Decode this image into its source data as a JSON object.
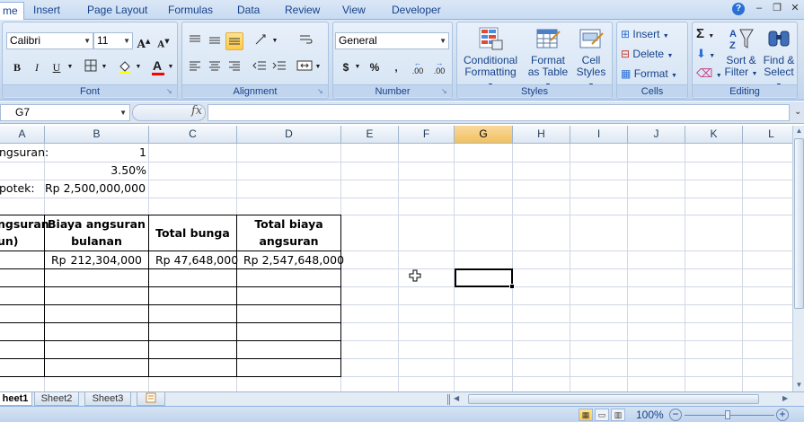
{
  "ribbon_tabs": [
    {
      "label": "me"
    },
    {
      "label": "Insert"
    },
    {
      "label": "Page Layout"
    },
    {
      "label": "Formulas"
    },
    {
      "label": "Data"
    },
    {
      "label": "Review"
    },
    {
      "label": "View"
    },
    {
      "label": "Developer"
    }
  ],
  "window_controls": {
    "minimize": "–",
    "restore": "❐",
    "close": "✕"
  },
  "groups": {
    "font": "Font",
    "alignment": "Alignment",
    "number": "Number",
    "styles": "Styles",
    "cells": "Cells",
    "editing": "Editing"
  },
  "font": {
    "name": "Calibri",
    "size": "11",
    "grow_icon": "A",
    "shrink_icon": "A",
    "bold": "B",
    "italic": "I",
    "underline": "U",
    "font_color_letter": "A",
    "font_color": "#ff0000"
  },
  "number": {
    "format": "General",
    "currency": "$",
    "percent": "%",
    "comma": ",",
    "inc_decimal": ".00",
    "dec_decimal": ".00"
  },
  "styles": {
    "conditional": [
      "Conditional",
      "Formatting"
    ],
    "format_table": [
      "Format",
      "as Table"
    ],
    "cell_styles": [
      "Cell",
      "Styles"
    ]
  },
  "cells": {
    "insert": "Insert",
    "delete": "Delete",
    "format": "Format"
  },
  "editing": {
    "sigma": "Σ",
    "sort_filter": [
      "Sort &",
      "Filter"
    ],
    "find_select": [
      "Find &",
      "Select"
    ]
  },
  "formula_bar": {
    "name_box": "G7",
    "fx": "fx",
    "formula": ""
  },
  "columns": [
    "A",
    "B",
    "C",
    "D",
    "E",
    "F",
    "G",
    "H",
    "I",
    "J",
    "K",
    "L"
  ],
  "selected_column": "G",
  "sheet": {
    "a1": "ngsuran:",
    "b1": "1",
    "b2": "3.50%",
    "a3": "potek:",
    "b3": "Rp 2,500,000,000",
    "a5_line1": "ngsuran",
    "a5_line2": "un)",
    "b5_line1": "Biaya angsuran",
    "b5_line2": "bulanan",
    "c5": "Total bunga",
    "d5_line1": "Total biaya",
    "d5_line2": "angsuran",
    "b6_prefix": "Rp",
    "b6_value": "212,304,000",
    "c6": "Rp 47,648,000",
    "d6": "Rp 2,547,648,000"
  },
  "sheet_tabs": [
    "heet1",
    "Sheet2",
    "Sheet3"
  ],
  "active_sheet": "heet1",
  "status": {
    "zoom": "100%",
    "zoom_out": "−",
    "zoom_in": "+"
  }
}
